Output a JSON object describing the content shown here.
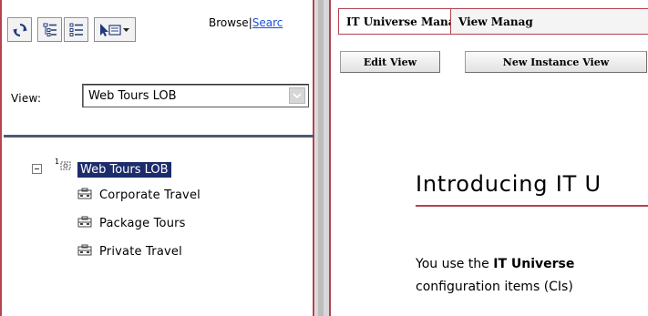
{
  "left_panel": {
    "toolbar": {
      "refresh_icon": "refresh-icon",
      "expand_all_icon": "expand-tree-icon",
      "collapse_all_icon": "list-icon",
      "view_options_icon": "view-menu-icon"
    },
    "browse_label": "Browse",
    "separator": "|",
    "search_label": "Searc",
    "view_label": "View:",
    "view_selected": "Web Tours LOB",
    "tree": {
      "root": {
        "badge": "1",
        "label": "Web Tours LOB"
      },
      "children": [
        {
          "label": "Corporate Travel"
        },
        {
          "label": "Package Tours"
        },
        {
          "label": "Private Travel"
        }
      ]
    }
  },
  "right_panel": {
    "tabs": [
      {
        "label": "IT Universe Manager",
        "active": true
      },
      {
        "label": "View Manag",
        "active": false
      }
    ],
    "buttons": {
      "edit_view": "Edit View",
      "new_instance_view": "New Instance View"
    },
    "heading": "Introducing IT U",
    "body_line1_prefix": "You use the ",
    "body_line1_bold": "IT Universe",
    "body_line2": "configuration items (CIs)"
  },
  "colors": {
    "accent_border": "#b34450",
    "selection_bg": "#1c2b6b",
    "link": "#1a4fd8"
  }
}
